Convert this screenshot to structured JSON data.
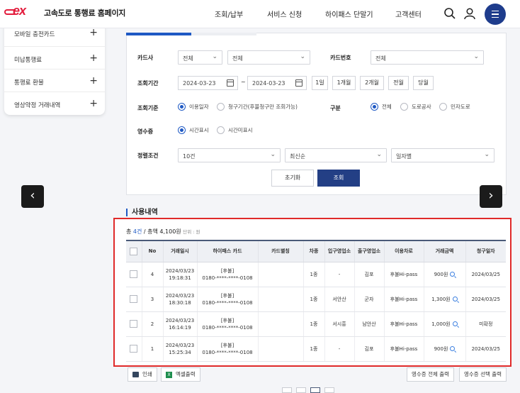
{
  "header": {
    "logo_mark": "ex",
    "title": "고속도로 통행료 홈페이지",
    "nav": [
      "조회/납부",
      "서비스 신청",
      "하이패스 단말기",
      "고객센터"
    ],
    "icons": [
      "search-icon",
      "user-icon",
      "menu-icon"
    ]
  },
  "sidebar": {
    "items": [
      {
        "label": "모바일 충전카드"
      },
      {
        "label": "미납통행료"
      },
      {
        "label": "통행료 환불"
      },
      {
        "label": "영상약정 거래내역"
      }
    ],
    "expand_symbol": "+"
  },
  "form": {
    "card_company_label": "카드사",
    "card_company_value": "전체",
    "card_type_value": "전체",
    "card_number_label": "카드번호",
    "card_number_value": "전체",
    "period_label": "조회기간",
    "date_from": "2024-03-23",
    "date_sep": "~",
    "date_to": "2024-03-23",
    "period_buttons": [
      "1일",
      "1개월",
      "2개월",
      "전월",
      "당월"
    ],
    "criteria_label": "조회기준",
    "criteria_options": [
      "이용일자",
      "청구기간(후불청구만 조회가능)"
    ],
    "section_label": "구분",
    "section_options": [
      "전체",
      "도로공사",
      "민자도로"
    ],
    "receipt_label": "영수증",
    "receipt_options": [
      "시간표시",
      "시간미표시"
    ],
    "sort_label": "정렬조건",
    "sort_count": "10건",
    "sort_order": "최신순",
    "sort_group": "일자별",
    "reset_button": "초기화",
    "search_button": "조회"
  },
  "nav_arrows": {
    "prev": "‹",
    "next": "›"
  },
  "usage": {
    "title": "사용내역",
    "summary_prefix": "총 ",
    "count": "4건",
    "summary_total": " / 총액 4,100원",
    "unit": "단위 : 원",
    "columns": [
      "No",
      "거래일시",
      "하이패스 카드",
      "카드별칭",
      "차종",
      "입구영업소",
      "출구영업소",
      "이용차로",
      "거래금액",
      "청구일자"
    ],
    "rows": [
      {
        "no": "4",
        "date": "2024/03/23",
        "time": "19:18:31",
        "card_type": "[후불]",
        "card_no": "0180-****-****-0108",
        "alias": "",
        "vehicle": "1종",
        "entry": "-",
        "exit": "김포",
        "lane": "후불Hi-pass",
        "amount": "900원",
        "bill_date": "2024/03/25"
      },
      {
        "no": "3",
        "date": "2024/03/23",
        "time": "18:30:18",
        "card_type": "[후불]",
        "card_no": "0180-****-****-0108",
        "alias": "",
        "vehicle": "1종",
        "entry": "서안산",
        "exit": "군자",
        "lane": "후불Hi-pass",
        "amount": "1,300원",
        "bill_date": "2024/03/25"
      },
      {
        "no": "2",
        "date": "2024/03/23",
        "time": "16:14:19",
        "card_type": "[후불]",
        "card_no": "0180-****-****-0108",
        "alias": "",
        "vehicle": "1종",
        "entry": "서시흥",
        "exit": "남안산",
        "lane": "후불Hi-pass",
        "amount": "1,000원",
        "bill_date": "미확정"
      },
      {
        "no": "1",
        "date": "2024/03/23",
        "time": "15:25:34",
        "card_type": "[후불]",
        "card_no": "0180-****-****-0108",
        "alias": "",
        "vehicle": "1종",
        "entry": "-",
        "exit": "김포",
        "lane": "후불Hi-pass",
        "amount": "900원",
        "bill_date": "2024/03/25"
      }
    ]
  },
  "actions": {
    "print": "인쇄",
    "excel": "엑셀출력",
    "excel_icon": "X",
    "receipt_all": "영수증 전체 출력",
    "receipt_selected": "영수증 선택 출력"
  },
  "colors": {
    "brand_red": "#e31d3d",
    "navy": "#1e3c8c",
    "accent_blue": "#1e59c4",
    "highlight_red": "#e02a2a"
  }
}
